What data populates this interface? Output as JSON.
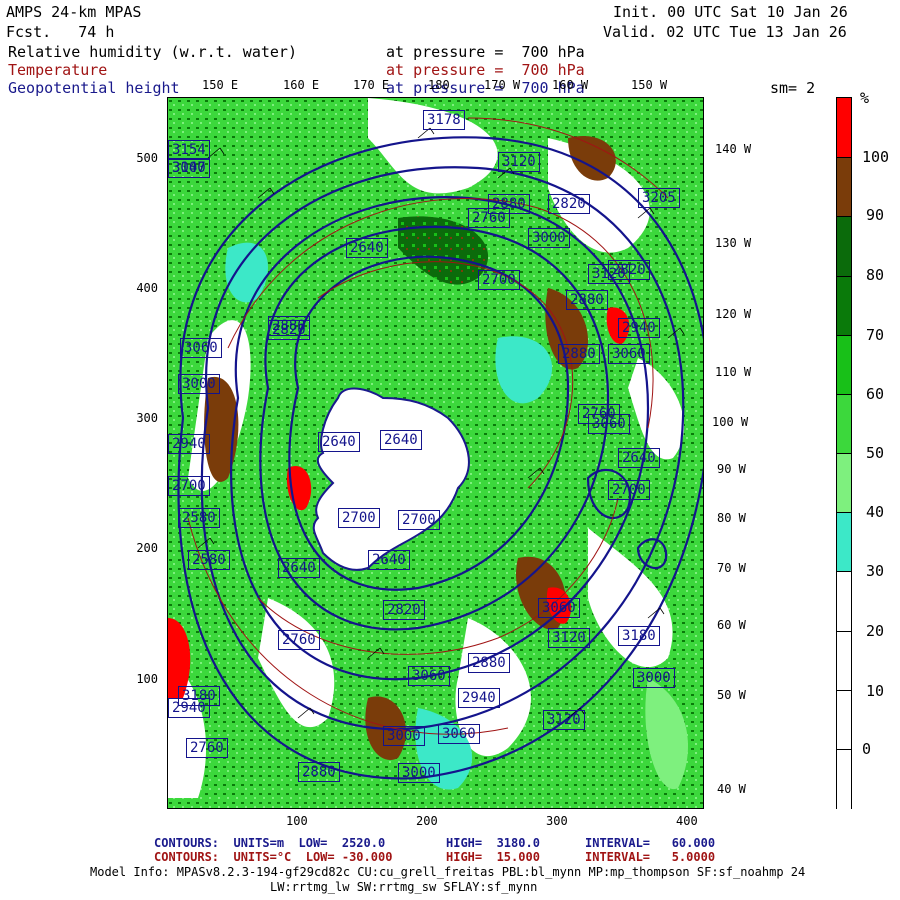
{
  "header": {
    "model_title": "AMPS 24-km MPAS",
    "forecast_label": "Fcst.   74 h",
    "init": "Init. 00 UTC Sat 10 Jan 26",
    "valid": "Valid. 02 UTC Tue 13 Jan 26",
    "field1": "Relative humidity (w.r.t. water)",
    "field1_level": "at pressure =  700 hPa",
    "field2": "Temperature",
    "field2_level": "at pressure =  700 hPa",
    "field3": "Geopotential height",
    "field3_level": "at pressure =  700 hPa",
    "smoothing": "sm= 2"
  },
  "colors": {
    "rh_white": "#ffffff",
    "rh_cyan": "#3ce8c8",
    "rh_lightgreen": "#7ef07e",
    "rh_green": "#3cd83c",
    "rh_medgreen": "#18c018",
    "rh_darkgreen": "#0a7a0a",
    "rh_darkergreen": "#0b6b0b",
    "rh_brown": "#7a3c0a",
    "rh_red": "#ff0000",
    "height_contour": "#14148c",
    "temp_contour": "#a01414",
    "land": "#ffffff"
  },
  "top_longitudes": [
    "150 E",
    "160 E",
    "170 E",
    "180",
    "170 W",
    "160 W",
    "150 W"
  ],
  "right_longitudes": [
    "140 W",
    "130 W",
    "120 W",
    "110 W",
    "100 W",
    "90 W",
    "80 W",
    "70 W",
    "60 W",
    "50 W",
    "40 W"
  ],
  "y_ticks": [
    "500",
    "400",
    "300",
    "200",
    "100"
  ],
  "x_ticks": [
    "100",
    "200",
    "300",
    "400"
  ],
  "colorbar": {
    "unit": "%",
    "labels": [
      "100",
      "90",
      "80",
      "70",
      "60",
      "50",
      "40",
      "30",
      "20",
      "10",
      "0"
    ],
    "bands": [
      "#ff0000",
      "#7a3c0a",
      "#0b6b0b",
      "#0a7a0a",
      "#18c018",
      "#3cd83c",
      "#7ef07e",
      "#3ce8c8",
      "#ffffff",
      "#ffffff",
      "#ffffff",
      "#ffffff"
    ]
  },
  "height_labels": [
    "3178",
    "3120",
    "3000",
    "2880",
    "2760",
    "2820",
    "2640",
    "2700",
    "3060",
    "3000",
    "2940",
    "2880",
    "2820",
    "2640",
    "2640",
    "2700",
    "2700",
    "2640",
    "2580",
    "2580",
    "2640",
    "2700",
    "2760",
    "2820",
    "2880",
    "2940",
    "3000",
    "3060",
    "3120",
    "3180",
    "3060",
    "3000",
    "2940",
    "2880",
    "2820",
    "2760",
    "2700",
    "2640",
    "3205",
    "3120",
    "3060",
    "2880",
    "3000",
    "3120",
    "3060",
    "3180",
    "2760",
    "2880",
    "3000",
    "3060",
    "2940",
    "3147",
    "3154"
  ],
  "footer": {
    "line1_label": "CONTOURS:  UNITS=m  LOW=  2520.0",
    "line1_high": "HIGH=  3180.0",
    "line1_interval": "INTERVAL=   60.000",
    "line2_label": "CONTOURS:  UNITS=°C  LOW= -30.000",
    "line2_high": "HIGH=  15.000",
    "line2_interval": "INTERVAL=   5.0000",
    "model_info": "Model Info: MPASv8.2.3-194-gf29cd82c CU:cu_grell_freitas PBL:bl_mynn MP:mp_thompson SF:sf_noahmp 24",
    "model_info2": "LW:rrtmg_lw SW:rrtmg_sw SFLAY:sf_mynn"
  }
}
